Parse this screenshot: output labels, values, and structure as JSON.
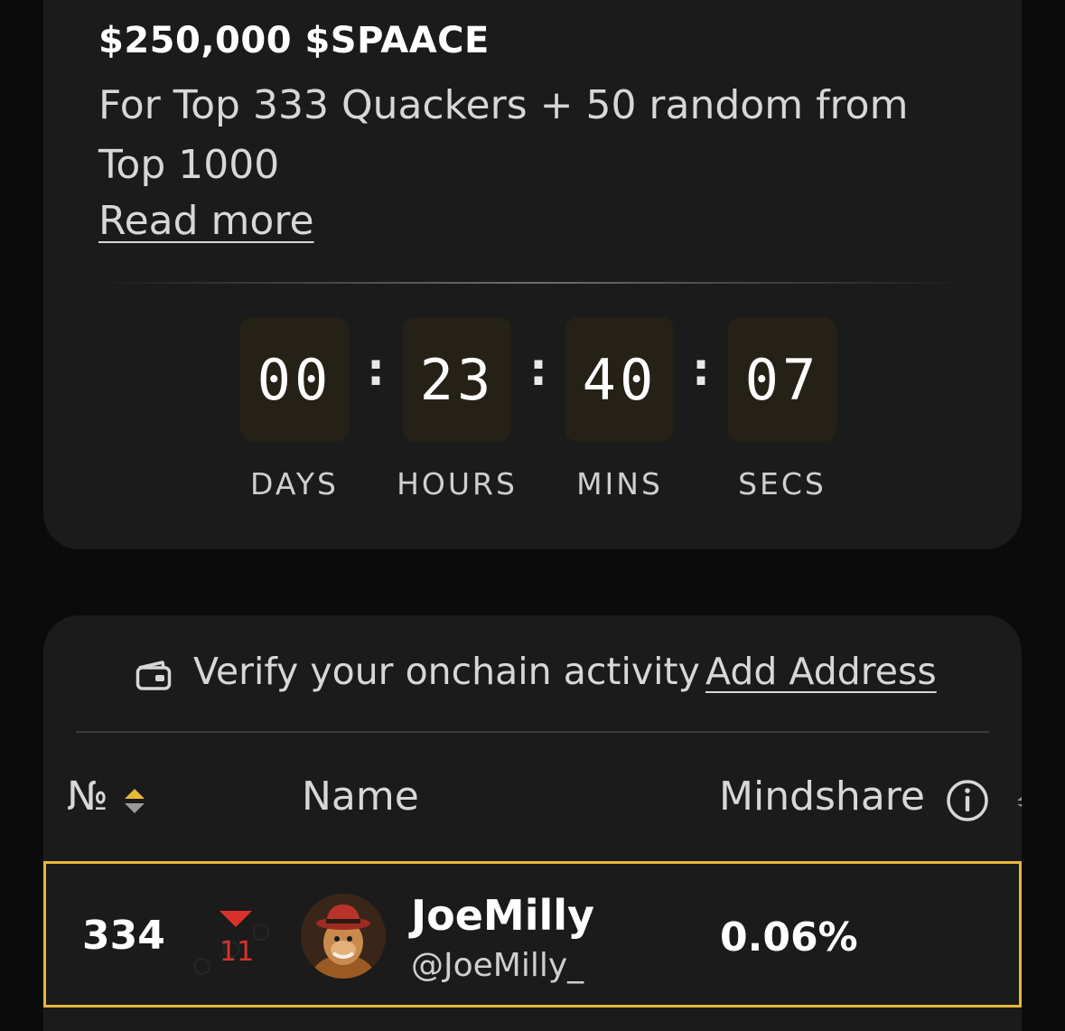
{
  "reward": {
    "title": "$250,000 $SPAACE",
    "description": "For Top 333 Quackers + 50 random from Top 1000",
    "read_more": "Read more"
  },
  "countdown": {
    "days": "00",
    "hours": "23",
    "mins": "40",
    "secs": "07",
    "separator": ":",
    "labels": {
      "days": "DAYS",
      "hours": "HOURS",
      "mins": "MINS",
      "secs": "SECS"
    }
  },
  "verify": {
    "text": "Verify your onchain activity",
    "action": "Add Address",
    "icon": "wallet-icon"
  },
  "table": {
    "headers": {
      "rank": "№",
      "name": "Name",
      "mindshare": "Mindshare"
    },
    "rows": [
      {
        "rank": "334",
        "change": "11",
        "change_direction": "down",
        "name": "JoeMilly",
        "handle": "@JoeMilly_",
        "mindshare": "0.06%"
      }
    ]
  },
  "colors": {
    "background": "#0b0b0b",
    "card": "#1b1b1b",
    "timer_box": "#262116",
    "highlight_border": "#e7b73a",
    "sort_accent": "#e7b73a",
    "down_red": "#d8322a"
  }
}
